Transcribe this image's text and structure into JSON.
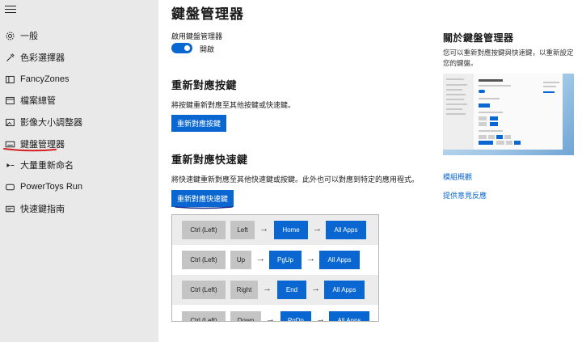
{
  "sidebar": {
    "items": [
      {
        "label": "一般",
        "icon": "gear-icon"
      },
      {
        "label": "色彩選擇器",
        "icon": "eyedropper-icon"
      },
      {
        "label": "FancyZones",
        "icon": "fancyzones-icon"
      },
      {
        "label": "檔案總管",
        "icon": "file-explorer-icon"
      },
      {
        "label": "影像大小調整器",
        "icon": "image-resizer-icon"
      },
      {
        "label": "鍵盤管理器",
        "icon": "keyboard-icon"
      },
      {
        "label": "大量重新命名",
        "icon": "rename-icon"
      },
      {
        "label": "PowerToys Run",
        "icon": "run-icon"
      },
      {
        "label": "快速鍵指南",
        "icon": "shortcut-guide-icon"
      }
    ],
    "active_index": 5
  },
  "main": {
    "title": "鍵盤管理器",
    "enable_label": "啟用鍵盤管理器",
    "toggle_state": "開啟",
    "toggle_on": true,
    "remap_keys": {
      "title": "重新對應按鍵",
      "description": "將按鍵重新對應至其他按鍵或快速鍵。",
      "button": "重新對應按鍵"
    },
    "remap_shortcuts": {
      "title": "重新對應快速鍵",
      "description": "將快速鍵重新對應至其他快速鍵或按鍵。此外也可以對應到特定的應用程式。",
      "button": "重新對應快速鍵"
    },
    "mappings": [
      {
        "from": [
          "Ctrl (Left)",
          "Left"
        ],
        "to": "Home",
        "app": "All Apps"
      },
      {
        "from": [
          "Ctrl (Left)",
          "Up"
        ],
        "to": "PgUp",
        "app": "All Apps"
      },
      {
        "from": [
          "Ctrl (Left)",
          "Right"
        ],
        "to": "End",
        "app": "All Apps"
      },
      {
        "from": [
          "Ctrl (Left)",
          "Down"
        ],
        "to": "PgDn",
        "app": "All Apps"
      }
    ],
    "arrow_glyph": "→"
  },
  "about": {
    "title": "關於鍵盤管理器",
    "description": "您可以重新對應按鍵與快速鍵，以重新設定您的鍵盤。",
    "links": [
      "模組概觀",
      "提供意見反應"
    ]
  },
  "colors": {
    "accent": "#0a67d1",
    "sidebar_bg": "#e9e9e9",
    "annotation_red": "#d42020",
    "annotation_navy": "#1a2a8a"
  }
}
